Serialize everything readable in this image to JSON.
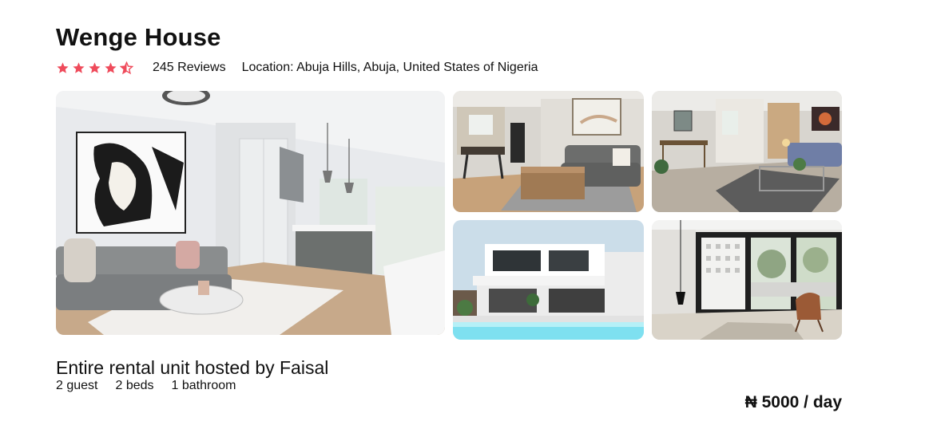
{
  "listing": {
    "title": "Wenge House",
    "rating": 4.5,
    "rating_max": 5,
    "star_color": "#ef4b5b",
    "reviews": "245 Reviews",
    "location": "Location: Abuja Hills, Abuja, United States of Nigeria"
  },
  "gallery": [
    {
      "name": "living-room-with-kitchen-photo"
    },
    {
      "name": "living-dining-room-photo"
    },
    {
      "name": "lounge-area-photo"
    },
    {
      "name": "modern-house-pool-photo"
    },
    {
      "name": "bedroom-window-photo"
    }
  ],
  "unit": {
    "title": "Entire rental unit hosted by Faisal",
    "guests": "2 guest",
    "beds": "2 beds",
    "bathrooms": "1 bathroom"
  },
  "pricing": {
    "price": "₦ 5000 / day"
  }
}
